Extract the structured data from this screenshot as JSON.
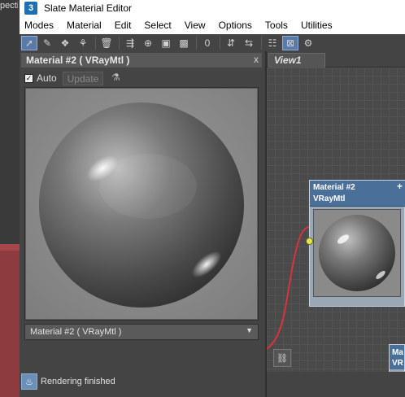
{
  "background": {
    "viewport_label": "pective"
  },
  "window": {
    "app_icon": "3",
    "title": "Slate Material Editor"
  },
  "menubar": {
    "items": [
      "Modes",
      "Material",
      "Edit",
      "Select",
      "View",
      "Options",
      "Tools",
      "Utilities"
    ]
  },
  "toolbar": {
    "buttons": [
      {
        "icon": "select-arrow-icon",
        "glyph": "➚",
        "active": true
      },
      {
        "icon": "eyedropper-icon",
        "glyph": "✎",
        "active": false
      },
      {
        "icon": "put-to-scene-icon",
        "glyph": "❖",
        "active": false
      },
      {
        "icon": "assign-to-selection-icon",
        "glyph": "⚘",
        "active": false
      },
      {
        "icon": "delete-icon",
        "glyph": "🗑",
        "active": false
      },
      {
        "icon": "move-children-icon",
        "glyph": "⇶",
        "active": false
      },
      {
        "icon": "hide-unused-icon",
        "glyph": "⊕",
        "active": false
      },
      {
        "icon": "show-map-icon",
        "glyph": "▣",
        "active": false
      },
      {
        "icon": "show-background-icon",
        "glyph": "▩",
        "active": false
      },
      {
        "icon": "material-id-icon",
        "glyph": "0",
        "active": false
      },
      {
        "icon": "layout-vertical-icon",
        "glyph": "⇵",
        "active": false
      },
      {
        "icon": "layout-horizontal-icon",
        "glyph": "⇆",
        "active": false
      },
      {
        "icon": "parameter-editor-icon",
        "glyph": "☷",
        "active": false
      },
      {
        "icon": "material-preview-icon",
        "glyph": "⊠",
        "active": true
      },
      {
        "icon": "select-by-material-icon",
        "glyph": "⚙",
        "active": false
      }
    ]
  },
  "preview": {
    "title": "Material #2  ( VRayMtl )",
    "close_glyph": "x",
    "auto_checked": true,
    "auto_label": "Auto",
    "update_label": "Update",
    "selected_material": "Material #2  ( VRayMtl )"
  },
  "status": {
    "text": "Rendering finished"
  },
  "view": {
    "tab_label": "View1",
    "node": {
      "title": "Material #2",
      "subtitle": "VRayMtl",
      "plus": "+"
    },
    "node2": {
      "text": "Ma\nVR"
    }
  },
  "colors": {
    "toolbar_bg": "#444444",
    "node_header": "#4a6f99",
    "wire": "#d8343c",
    "input_dot": "#e6e64a"
  }
}
